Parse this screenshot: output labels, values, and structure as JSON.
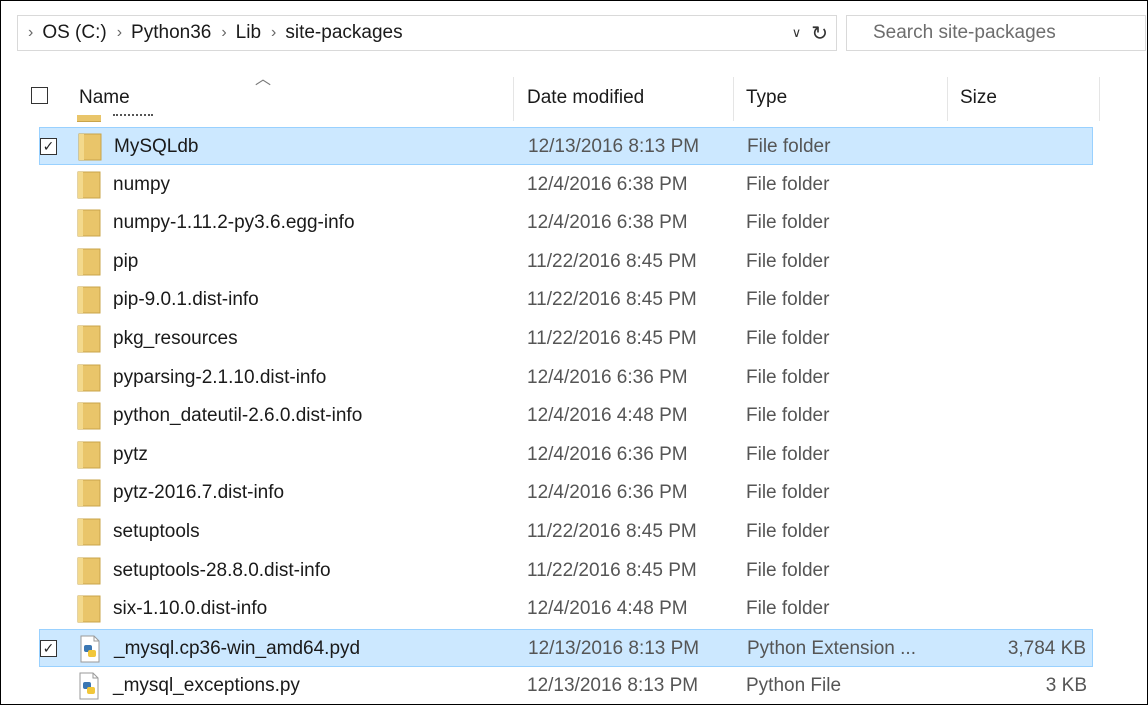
{
  "address": {
    "crumbs": [
      "OS (C:)",
      "Python36",
      "Lib",
      "site-packages"
    ]
  },
  "search": {
    "placeholder": "Search site-packages"
  },
  "columns": {
    "name": "Name",
    "date": "Date modified",
    "type": "Type",
    "size": "Size"
  },
  "files": [
    {
      "name": "MySQLdb",
      "date": "12/13/2016 8:13 PM",
      "type": "File folder",
      "size": "",
      "icon": "folder-icon",
      "selected": true
    },
    {
      "name": "numpy",
      "date": "12/4/2016 6:38 PM",
      "type": "File folder",
      "size": "",
      "icon": "folder-icon",
      "selected": false
    },
    {
      "name": "numpy-1.11.2-py3.6.egg-info",
      "date": "12/4/2016 6:38 PM",
      "type": "File folder",
      "size": "",
      "icon": "folder-icon",
      "selected": false
    },
    {
      "name": "pip",
      "date": "11/22/2016 8:45 PM",
      "type": "File folder",
      "size": "",
      "icon": "folder-icon",
      "selected": false
    },
    {
      "name": "pip-9.0.1.dist-info",
      "date": "11/22/2016 8:45 PM",
      "type": "File folder",
      "size": "",
      "icon": "folder-icon",
      "selected": false
    },
    {
      "name": "pkg_resources",
      "date": "11/22/2016 8:45 PM",
      "type": "File folder",
      "size": "",
      "icon": "folder-icon",
      "selected": false
    },
    {
      "name": "pyparsing-2.1.10.dist-info",
      "date": "12/4/2016 6:36 PM",
      "type": "File folder",
      "size": "",
      "icon": "folder-icon",
      "selected": false
    },
    {
      "name": "python_dateutil-2.6.0.dist-info",
      "date": "12/4/2016 4:48 PM",
      "type": "File folder",
      "size": "",
      "icon": "folder-icon",
      "selected": false
    },
    {
      "name": "pytz",
      "date": "12/4/2016 6:36 PM",
      "type": "File folder",
      "size": "",
      "icon": "folder-icon",
      "selected": false
    },
    {
      "name": "pytz-2016.7.dist-info",
      "date": "12/4/2016 6:36 PM",
      "type": "File folder",
      "size": "",
      "icon": "folder-icon",
      "selected": false
    },
    {
      "name": "setuptools",
      "date": "11/22/2016 8:45 PM",
      "type": "File folder",
      "size": "",
      "icon": "folder-icon",
      "selected": false
    },
    {
      "name": "setuptools-28.8.0.dist-info",
      "date": "11/22/2016 8:45 PM",
      "type": "File folder",
      "size": "",
      "icon": "folder-icon",
      "selected": false
    },
    {
      "name": "six-1.10.0.dist-info",
      "date": "12/4/2016 4:48 PM",
      "type": "File folder",
      "size": "",
      "icon": "folder-icon",
      "selected": false
    },
    {
      "name": "_mysql.cp36-win_amd64.pyd",
      "date": "12/13/2016 8:13 PM",
      "type": "Python Extension ...",
      "size": "3,784 KB",
      "icon": "python-file-icon",
      "selected": true
    },
    {
      "name": "_mysql_exceptions.py",
      "date": "12/13/2016 8:13 PM",
      "type": "Python File",
      "size": "3 KB",
      "icon": "python-file-icon",
      "selected": false
    }
  ],
  "colors": {
    "selection_bg": "#cce8ff",
    "selection_border": "#99d1ff",
    "folder": "#e9c56a"
  }
}
